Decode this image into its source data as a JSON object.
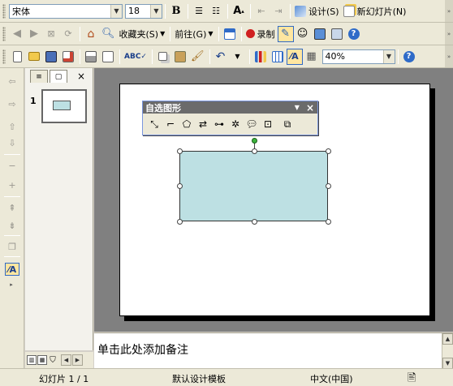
{
  "format_toolbar": {
    "font_name": "宋体",
    "font_size": "18",
    "design_label": "设计(S)",
    "new_slide_label": "新幻灯片(N)"
  },
  "web_toolbar": {
    "favorites_label": "收藏夹(S)",
    "go_label": "前往(G)",
    "record_label": "录制"
  },
  "standard_toolbar": {
    "zoom": "40%"
  },
  "outline": {
    "slide_number": "1"
  },
  "drawing_toolbar": {
    "title": "自选图形"
  },
  "notes": {
    "placeholder": "单击此处添加备注"
  },
  "statusbar": {
    "slide_info": "幻灯片 1 / 1",
    "template": "默认设计模板",
    "language": "中文(中国)"
  },
  "colors": {
    "rectangle_fill": "#bde0e3",
    "toolbar_bg": "#ece9d8",
    "slide_bg": "#808080",
    "record_red": "#d02020"
  }
}
